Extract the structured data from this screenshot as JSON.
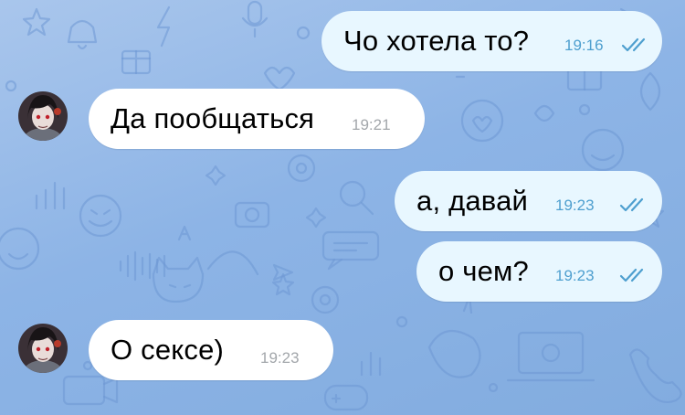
{
  "chat": {
    "messages": [
      {
        "direction": "outgoing",
        "text": "Чо хотела то?",
        "time": "19:16",
        "status": "read",
        "status_icon": "double-check-icon"
      },
      {
        "direction": "incoming",
        "text": "Да пообщаться",
        "time": "19:21",
        "avatar": "user-avatar"
      },
      {
        "direction": "outgoing",
        "text": "а, давай",
        "time": "19:23",
        "status": "read",
        "status_icon": "double-check-icon"
      },
      {
        "direction": "outgoing",
        "text": "о чем?",
        "time": "19:23",
        "status": "read",
        "status_icon": "double-check-icon"
      },
      {
        "direction": "incoming",
        "text": "О сексе)",
        "time": "19:23",
        "avatar": "user-avatar"
      }
    ]
  },
  "colors": {
    "background": "#8db4e6",
    "pattern": "#6e98d3",
    "outgoing_bubble": "#e8f7ff",
    "incoming_bubble": "#ffffff",
    "outgoing_time": "#4e9fcf",
    "incoming_time": "#a3a7ab"
  }
}
